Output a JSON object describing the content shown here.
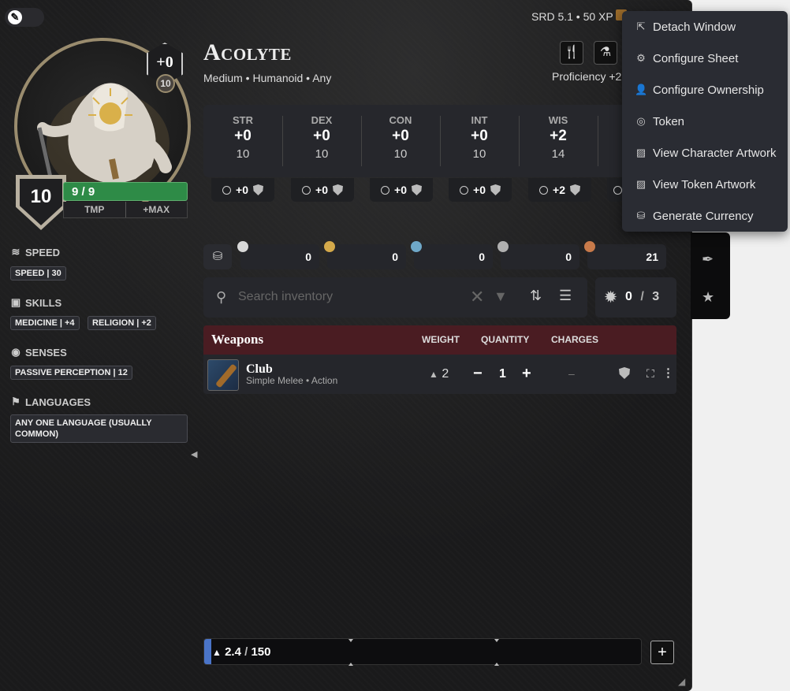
{
  "header": {
    "xp": "SRD 5.1 • 50 XP",
    "name": "Acolyte",
    "subtitle": "Medium • Humanoid • Any",
    "proficiency": "Proficiency +2",
    "d20_mod": "+0",
    "d20_score": "10"
  },
  "vitals": {
    "ac": "10",
    "hp": "9 / 9",
    "hp_fraction": 1.0,
    "tmp_label": "TMP",
    "max_label": "+MAX"
  },
  "abilities": [
    {
      "abbr": "STR",
      "mod": "+0",
      "score": "10",
      "save": "+0"
    },
    {
      "abbr": "DEX",
      "mod": "+0",
      "score": "10",
      "save": "+0"
    },
    {
      "abbr": "CON",
      "mod": "+0",
      "score": "10",
      "save": "+0"
    },
    {
      "abbr": "INT",
      "mod": "+0",
      "score": "10",
      "save": "+0"
    },
    {
      "abbr": "WIS",
      "mod": "+2",
      "score": "14",
      "save": "+2"
    }
  ],
  "sidebar": {
    "speed_title": "SPEED",
    "speed_value": "SPEED | 30",
    "skills_title": "SKILLS",
    "skill_1": "MEDICINE | +4",
    "skill_2": "RELIGION | +2",
    "senses_title": "SENSES",
    "senses_value": "PASSIVE PERCEPTION | 12",
    "languages_title": "LANGUAGES",
    "languages_value": "ANY ONE LANGUAGE (USUALLY COMMON)"
  },
  "currency": [
    {
      "name": "pp",
      "value": "0",
      "color": "#d8d8d8"
    },
    {
      "name": "gp",
      "value": "0",
      "color": "#d4a94a"
    },
    {
      "name": "ep",
      "value": "0",
      "color": "#6fa8c8"
    },
    {
      "name": "sp",
      "value": "0",
      "color": "#b0b0b0"
    },
    {
      "name": "cp",
      "value": "21",
      "color": "#c87a4a"
    }
  ],
  "search": {
    "placeholder": "Search inventory"
  },
  "attunement": {
    "current": "0",
    "sep": "/",
    "max": "3"
  },
  "inventory": {
    "category": "Weapons",
    "col_weight": "WEIGHT",
    "col_quantity": "QUANTITY",
    "col_charges": "CHARGES",
    "items": [
      {
        "name": "Club",
        "subtitle": "Simple Melee • Action",
        "weight": "2",
        "quantity": "1",
        "charges": "–"
      }
    ]
  },
  "encumbrance": {
    "value": "2.4",
    "sep": " / ",
    "max": "150",
    "fraction": 0.016
  },
  "menu": {
    "items": [
      {
        "label": "Detach Window",
        "icon": "external-link-icon"
      },
      {
        "label": "Configure Sheet",
        "icon": "gear-icon"
      },
      {
        "label": "Configure Ownership",
        "icon": "user-lock-icon"
      },
      {
        "label": "Token",
        "icon": "user-circle-icon"
      },
      {
        "label": "View Character Artwork",
        "icon": "image-icon"
      },
      {
        "label": "View Token Artwork",
        "icon": "image-icon"
      },
      {
        "label": "Generate Currency",
        "icon": "coins-icon"
      }
    ]
  },
  "colors": {
    "accent_hp": "#2e8b47",
    "inventory_header": "#4a1c22",
    "encumbrance_fill": "#4a74c8"
  }
}
